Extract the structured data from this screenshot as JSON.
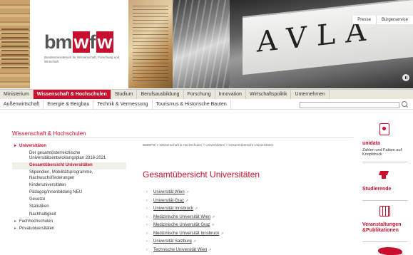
{
  "header": {
    "logo_prefix": "bm",
    "logo_w1": "w",
    "logo_f": "f",
    "logo_w2": "w",
    "logo_sub": "Bundesministerium für Wissenschaft, Forschung und Wirtschaft",
    "banner_word": "AVLA",
    "top_links": [
      "Presse",
      "Bürgerservice"
    ]
  },
  "main_nav": {
    "items": [
      "Ministerium",
      "Wissenschaft & Hochschulen",
      "Studium",
      "Berufsausbildung",
      "Forschung",
      "Innovation",
      "Wirtschaftspolitik",
      "Unternehmen"
    ],
    "active_index": 1
  },
  "sub_nav": {
    "items": [
      "Außenwirtschaft",
      "Energie & Bergbau",
      "Technik & Vermessung",
      "Tourismus & Historische Bauten"
    ],
    "search_placeholder": ""
  },
  "section_title": "Wissenschaft & Hochschulen",
  "sidebar": {
    "items": [
      {
        "label": "Universitäten",
        "kind": "top"
      },
      {
        "label": "Der gesamtösterreichische Universitätsentwicklungsplan 2016-2021",
        "kind": "plain"
      },
      {
        "label": "Gesamtübersicht Universitäten",
        "kind": "active"
      },
      {
        "label": "Stipendien, Mobilitätsprogramme, Nachwuchsförderungen",
        "kind": "plain"
      },
      {
        "label": "Kinderuniversitäten",
        "kind": "plain"
      },
      {
        "label": "Pädagog/innenbildung NEU",
        "kind": "plain"
      },
      {
        "label": "Gesetze",
        "kind": "plain"
      },
      {
        "label": "Statistiken",
        "kind": "plain"
      },
      {
        "label": "Nachhaltigkeit",
        "kind": "plain"
      },
      {
        "label": "Fachhochschulen",
        "kind": "top2"
      },
      {
        "label": "Privatuniversitäten",
        "kind": "top2"
      }
    ]
  },
  "breadcrumb": "BMWFW > Wissenschaft & Hochschulen > Universitäten > Gesamtübersicht Universitäten",
  "page_title": "Gesamtübersicht Universitäten",
  "universities": [
    "Universität Wien",
    "Universität Graz",
    "Universität Innsbruck",
    "Medizinische Universität Wien",
    "Medizinische Universität Graz",
    "Medizinische Universität Innsbruck",
    "Universität Salzburg",
    "Technische Universität Wien"
  ],
  "right_boxes": {
    "umidata": {
      "title": "unidata",
      "text": "Zahlen und Fakten auf Knopfdruck"
    },
    "studierende": {
      "title": "Studierende"
    },
    "veranstaltungen": {
      "title": "Veranstaltungen &Publikationen"
    }
  },
  "colors": {
    "accent": "#c8102e",
    "nav_bg": "#e9e6dc"
  }
}
